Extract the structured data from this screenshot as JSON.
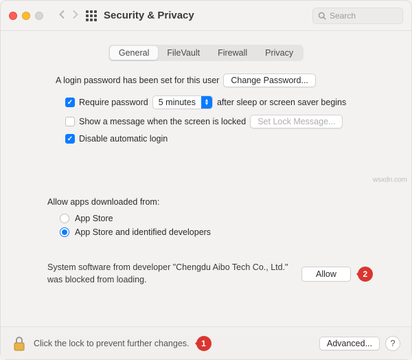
{
  "header": {
    "title": "Security & Privacy",
    "search_placeholder": "Search"
  },
  "tabs": {
    "items": [
      "General",
      "FileVault",
      "Firewall",
      "Privacy"
    ],
    "selected": 0
  },
  "login": {
    "password_set_text": "A login password has been set for this user",
    "change_password_btn": "Change Password...",
    "require_password_label": "Require password",
    "require_password_checked": true,
    "delay_value": "5 minutes",
    "after_sleep_text": "after sleep or screen saver begins",
    "show_message_label": "Show a message when the screen is locked",
    "show_message_checked": false,
    "set_lock_message_btn": "Set Lock Message...",
    "disable_auto_login_label": "Disable automatic login",
    "disable_auto_login_checked": true
  },
  "download": {
    "heading": "Allow apps downloaded from:",
    "options": [
      "App Store",
      "App Store and identified developers"
    ],
    "selected": 1
  },
  "blocked": {
    "text": "System software from developer \"Chengdu Aibo Tech Co., Ltd.\" was blocked from loading.",
    "allow_btn": "Allow"
  },
  "footer": {
    "lock_text": "Click the lock to prevent further changes.",
    "advanced_btn": "Advanced...",
    "help": "?"
  },
  "markers": {
    "m1": "1",
    "m2": "2"
  },
  "watermark": "wsxdn.com"
}
